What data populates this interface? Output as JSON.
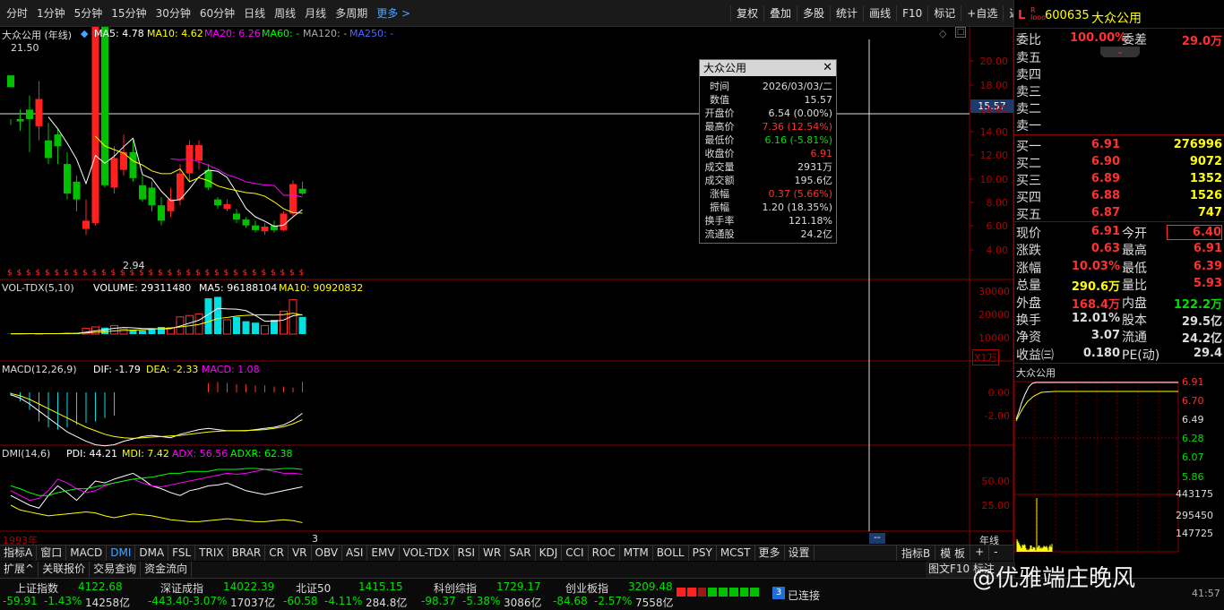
{
  "toolbar": {
    "periods": [
      "分时",
      "1分钟",
      "5分钟",
      "15分钟",
      "30分钟",
      "60分钟",
      "日线",
      "周线",
      "月线",
      "多周期",
      "更多 >"
    ],
    "right": [
      "复权",
      "叠加",
      "多股",
      "统计",
      "画线",
      "F10",
      "标记",
      "+自选",
      "返回"
    ]
  },
  "main": {
    "name_label": "大众公用 (年线)",
    "ma5": "MA5: 4.78",
    "ma10": "MA10: 4.62",
    "ma20": "MA20: 6.26",
    "ma60": "MA60: -",
    "ma120": "MA120: -",
    "ma250": "MA250: -",
    "high_mark": "21.50",
    "low_mark": "2.94",
    "cursor_price": "15.57",
    "y_ticks": [
      "20.00",
      "18.00",
      "16.00",
      "14.00",
      "12.00",
      "10.00",
      "8.00",
      "6.00",
      "4.00"
    ]
  },
  "vol": {
    "label": "VOL-TDX(5,10)",
    "volume": "VOLUME: 29311480",
    "ma5": "MA5: 96188104",
    "ma10": "MA10: 90920832",
    "y_ticks": [
      "30000",
      "20000",
      "10000"
    ],
    "unit": "X1万"
  },
  "macd": {
    "label": "MACD(12,26,9)",
    "dif": "DIF: -1.79",
    "dea": "DEA: -2.33",
    "macd": "MACD: 1.08",
    "y_ticks": [
      "0.00",
      "-2.00"
    ]
  },
  "dmi": {
    "label": "DMI(14,6)",
    "pdi": "PDI: 44.21",
    "mdi": "MDI: 7.42",
    "adx": "ADX: 56.56",
    "adxr": "ADXR: 62.38",
    "y_ticks": [
      "50.00",
      "25.00"
    ]
  },
  "xaxis": {
    "start": "1993年",
    "mark": "3",
    "right": "年线"
  },
  "tooltip": {
    "title": "大众公用",
    "rows": [
      [
        "时间",
        "2026/03/03/二",
        "#ddd"
      ],
      [
        "数值",
        "15.57",
        "#ddd"
      ],
      [
        "开盘价",
        "6.54 (0.00%)",
        "#ddd"
      ],
      [
        "最高价",
        "7.36 (12.54%)",
        "#ff3030"
      ],
      [
        "最低价",
        "6.16 (-5.81%)",
        "#00e000"
      ],
      [
        "收盘价",
        "6.91",
        "#ff3030"
      ],
      [
        "成交量",
        "2931万",
        "#ddd"
      ],
      [
        "成交额",
        "195.6亿",
        "#ddd"
      ],
      [
        "涨幅",
        "0.37 (5.66%)",
        "#ff3030"
      ],
      [
        "振幅",
        "1.20 (18.35%)",
        "#ddd"
      ],
      [
        "换手率",
        "121.18%",
        "#ddd"
      ],
      [
        "流通股",
        "24.2亿",
        "#ddd"
      ]
    ]
  },
  "stock": {
    "code": "600635",
    "name": "大众公用",
    "weibi_label": "委比",
    "weibi": "100.00%",
    "weicha_label": "委差",
    "weicha": "29.0万",
    "sells": [
      "卖五",
      "卖四",
      "卖三",
      "卖二",
      "卖一"
    ],
    "buys": [
      [
        "买一",
        "6.91",
        "276996"
      ],
      [
        "买二",
        "6.90",
        "9072"
      ],
      [
        "买三",
        "6.89",
        "1352"
      ],
      [
        "买四",
        "6.88",
        "1526"
      ],
      [
        "买五",
        "6.87",
        "747"
      ]
    ],
    "quote": [
      [
        "现价",
        "6.91",
        "今开",
        "6.40"
      ],
      [
        "涨跌",
        "0.63",
        "最高",
        "6.91"
      ],
      [
        "涨幅",
        "10.03%",
        "最低",
        "6.39"
      ],
      [
        "总量",
        "290.6万",
        "量比",
        "5.93"
      ],
      [
        "外盘",
        "168.4万",
        "内盘",
        "122.2万"
      ],
      [
        "换手",
        "12.01%",
        "股本",
        "29.5亿"
      ],
      [
        "净资",
        "3.07",
        "流通",
        "24.2亿"
      ],
      [
        "收益㈢",
        "0.180",
        "PE(动)",
        "29.4"
      ]
    ],
    "mini_title": "大众公用",
    "mini_ticks": [
      "6.91",
      "6.70",
      "6.49",
      "6.28",
      "6.07",
      "5.86"
    ],
    "mini_vol": [
      "443175",
      "295450",
      "147725"
    ]
  },
  "tabs": [
    "指标A",
    "窗口",
    "MACD",
    "DMI",
    "DMA",
    "FSL",
    "TRIX",
    "BRAR",
    "CR",
    "VR",
    "OBV",
    "ASI",
    "EMV",
    "VOL-TDX",
    "RSI",
    "WR",
    "SAR",
    "KDJ",
    "CCI",
    "ROC",
    "MTM",
    "BOLL",
    "PSY",
    "MCST",
    "更多",
    "设置"
  ],
  "tabs_right": [
    "指标B",
    "模 板",
    "+",
    "-"
  ],
  "sub": [
    "扩展^",
    "关联报价",
    "交易查询",
    "资金流向"
  ],
  "indices": [
    {
      "name": "上证指数",
      "val": "4122.68",
      "chg": "-59.91",
      "pct": "-1.43%",
      "amt": "14258亿"
    },
    {
      "name": "深证成指",
      "val": "14022.39",
      "chg": "-443.40",
      "pct": "-3.07%",
      "amt": "17037亿"
    },
    {
      "name": "北证50",
      "val": "1415.15",
      "chg": "-60.58",
      "pct": "-4.11%",
      "amt": "284.8亿"
    },
    {
      "name": "科创综指",
      "val": "1729.17",
      "chg": "-98.37",
      "pct": "-5.38%",
      "amt": "3086亿"
    },
    {
      "name": "创业板指",
      "val": "3209.48",
      "chg": "-84.68",
      "pct": "-2.57%",
      "amt": "7558亿"
    }
  ],
  "status": {
    "conn_num": "3",
    "conn": "已连接",
    "watermark": "@优雅端庄晚风",
    "time": "41:57"
  }
}
